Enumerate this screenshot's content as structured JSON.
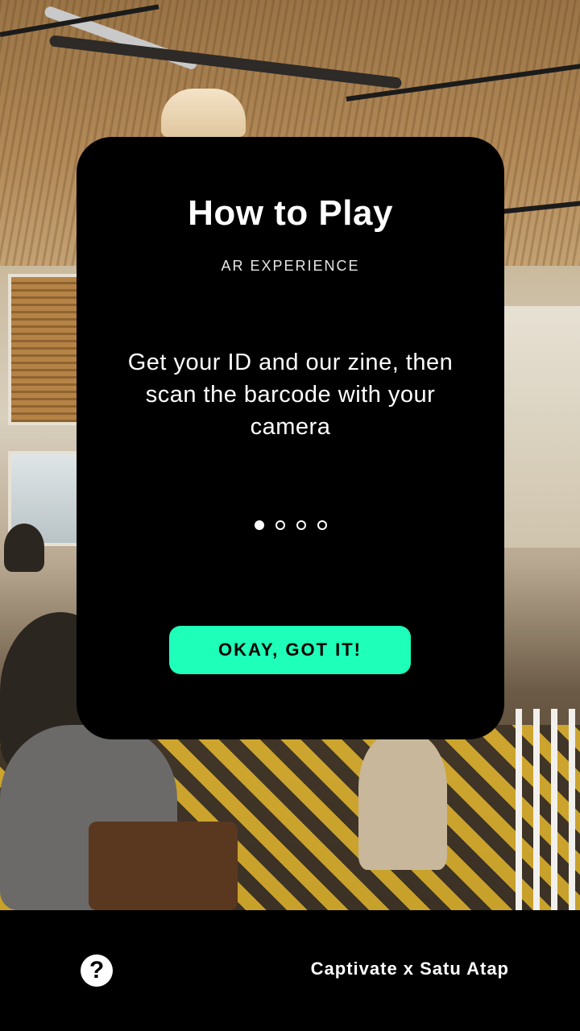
{
  "modal": {
    "title": "How to Play",
    "subtitle": "AR EXPERIENCE",
    "body": "Get your ID and our zine, then scan the barcode with your camera",
    "pagination": {
      "total": 4,
      "current": 1
    },
    "confirm_label": "OKAY, GOT IT!"
  },
  "footer": {
    "help_icon": "question-circle-icon",
    "help_glyph": "?",
    "brand_text": "Captivate x Satu Atap"
  },
  "colors": {
    "card_background": "#000000",
    "button_accent": "#1effb9",
    "footer_background": "#000000"
  }
}
